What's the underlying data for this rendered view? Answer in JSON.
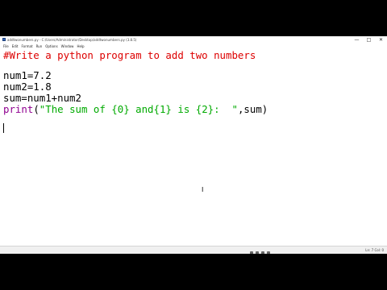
{
  "window": {
    "title": "addtwonumbers.py - C:/Users/Administrator/Desktop/addtwonumbers.py (3.8.5)",
    "controls": {
      "minimize": "—",
      "maximize": "□",
      "close": "✕"
    }
  },
  "menu": [
    "File",
    "Edit",
    "Format",
    "Run",
    "Options",
    "Window",
    "Help"
  ],
  "code": {
    "line1": "#Write a python program to add two numbers",
    "line3": "num1=7.2",
    "line4": "num2=1.8",
    "line5": "sum=num1+num2",
    "line6_func": "print",
    "line6_open": "(",
    "line6_string": "\"The sum of {0} and{1} is {2}:  \"",
    "line6_rest": ",sum)"
  },
  "statusbar": {
    "position": "Ln: 7 Col: 0"
  },
  "tray": [
    "cloud-icon",
    "network-icon",
    "volume-icon",
    "mic-icon"
  ],
  "colors": {
    "comment": "#dd0000",
    "builtin": "#900090",
    "string": "#00aa00"
  }
}
